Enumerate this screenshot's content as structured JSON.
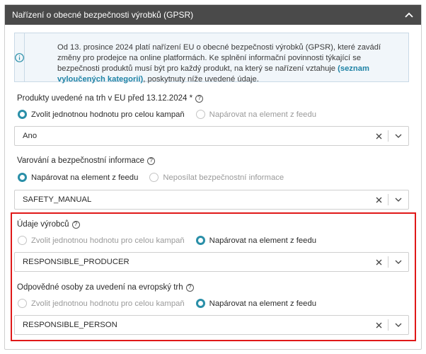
{
  "panel": {
    "title": "Nařízení o obecné bezpečnosti výrobků (GPSR)",
    "collapse_icon": "chevron-up-icon"
  },
  "info": {
    "icon": "info-icon",
    "text_before": "Od 13. prosince 2024 platí nařízení EU o obecné bezpečnosti výrobků (GPSR), které zavádí změny pro prodejce na online platformách. Ke splnění informační povinnosti týkající se bezpečnosti produktů musí být pro každý produkt, na který se nařízení vztahuje ",
    "link_text": "(seznam vyloučených kategorií)",
    "text_after": ", poskytnuty níže uvedené údaje."
  },
  "fields": [
    {
      "label": "Produkty uvedené na trh v EU před 13.12.2024 *",
      "options": [
        "Zvolit jednotnou hodnotu pro celou kampaň",
        "Napárovat na element z feedu"
      ],
      "selected": 0,
      "value": "Ano"
    },
    {
      "label": "Varování a bezpečnostní informace",
      "options": [
        "Napárovat na element z feedu",
        "Neposílat bezpečnostní informace"
      ],
      "selected": 0,
      "value": "SAFETY_MANUAL"
    },
    {
      "label": "Údaje výrobců",
      "options": [
        "Zvolit jednotnou hodnotu pro celou kampaň",
        "Napárovat na element z feedu"
      ],
      "selected": 1,
      "value": "RESPONSIBLE_PRODUCER"
    },
    {
      "label": "Odpovědné osoby za uvedení na evropský trh",
      "options": [
        "Zvolit jednotnou hodnotu pro celou kampaň",
        "Napárovat na element z feedu"
      ],
      "selected": 1,
      "value": "RESPONSIBLE_PERSON"
    }
  ],
  "colors": {
    "header_bg": "#4a4a4a",
    "accent": "#2a8fa8",
    "highlight": "#e01818",
    "info_bg": "#f1f6fa"
  }
}
